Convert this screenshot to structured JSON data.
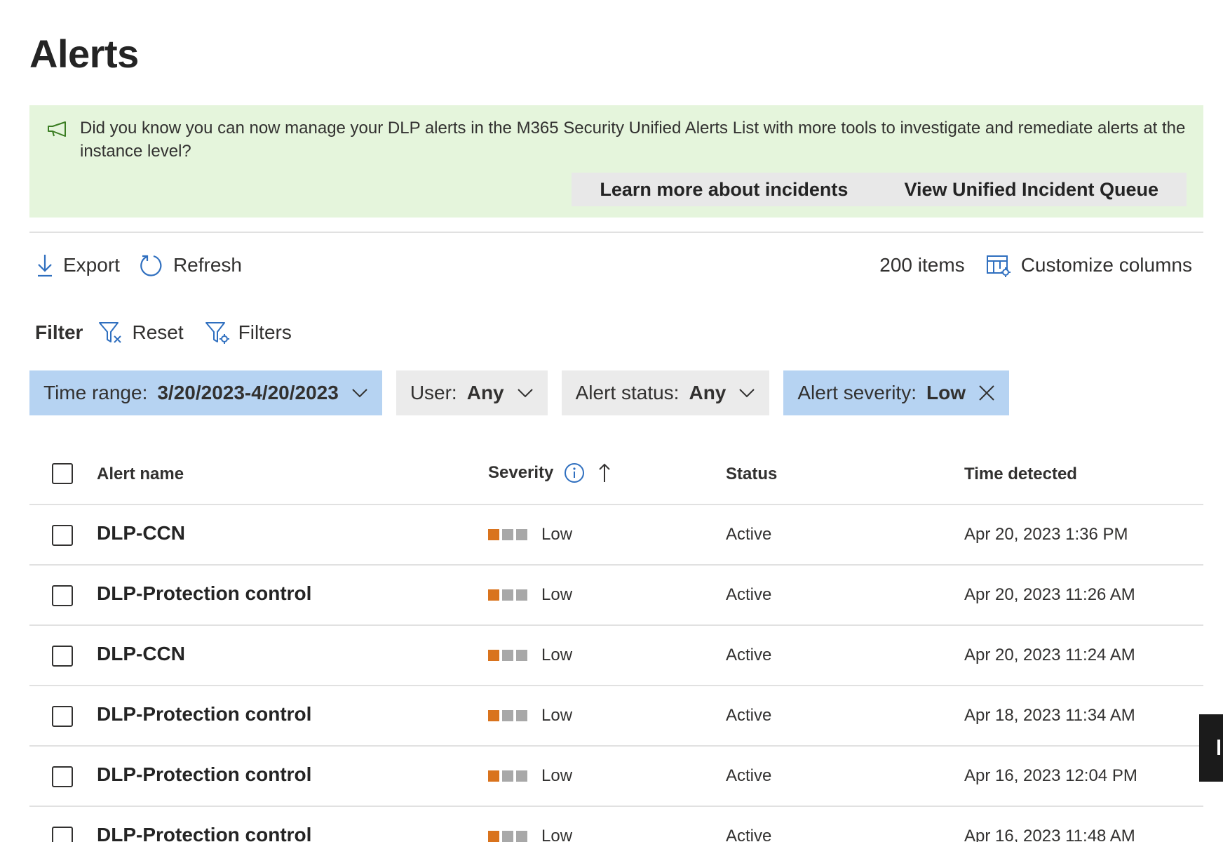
{
  "page": {
    "title": "Alerts"
  },
  "banner": {
    "message": "Did you know you can now manage your DLP alerts in the M365 Security Unified Alerts List with more tools to investigate and remediate alerts at the instance level?",
    "buttons": [
      "Learn more about incidents",
      "View Unified Incident Queue"
    ]
  },
  "toolbar": {
    "export_label": "Export",
    "refresh_label": "Refresh",
    "item_count": "200 items",
    "customize_label": "Customize columns"
  },
  "filter": {
    "label": "Filter",
    "reset_label": "Reset",
    "filters_label": "Filters",
    "chips": [
      {
        "key": "Time range:",
        "value": "3/20/2023-4/20/2023",
        "state": "active",
        "control": "chevron-down"
      },
      {
        "key": "User:",
        "value": "Any",
        "state": "neutral",
        "control": "chevron-down"
      },
      {
        "key": "Alert status:",
        "value": "Any",
        "state": "neutral",
        "control": "chevron-down"
      },
      {
        "key": "Alert severity:",
        "value": "Low",
        "state": "active",
        "control": "close"
      }
    ]
  },
  "table": {
    "columns": [
      "Alert name",
      "Severity",
      "Status",
      "Time detected"
    ],
    "severity_colors": {
      "filled": "#d9731d",
      "empty": "#a8a8a8"
    },
    "rows": [
      {
        "name": "DLP-CCN",
        "severity": "Low",
        "status": "Active",
        "time": "Apr 20, 2023 1:36 PM"
      },
      {
        "name": "DLP-Protection control",
        "severity": "Low",
        "status": "Active",
        "time": "Apr 20, 2023 11:26 AM"
      },
      {
        "name": "DLP-CCN",
        "severity": "Low",
        "status": "Active",
        "time": "Apr 20, 2023 11:24 AM"
      },
      {
        "name": "DLP-Protection control",
        "severity": "Low",
        "status": "Active",
        "time": "Apr 18, 2023 11:34 AM"
      },
      {
        "name": "DLP-Protection control",
        "severity": "Low",
        "status": "Active",
        "time": "Apr 16, 2023 12:04 PM"
      },
      {
        "name": "DLP-Protection control",
        "severity": "Low",
        "status": "Active",
        "time": "Apr 16, 2023 11:48 AM"
      }
    ]
  },
  "colors": {
    "banner_bg": "#e5f5dc",
    "chip_active_bg": "#b6d3f2",
    "chip_neutral_bg": "#ebebeb",
    "accent": "#2f6fbf"
  }
}
